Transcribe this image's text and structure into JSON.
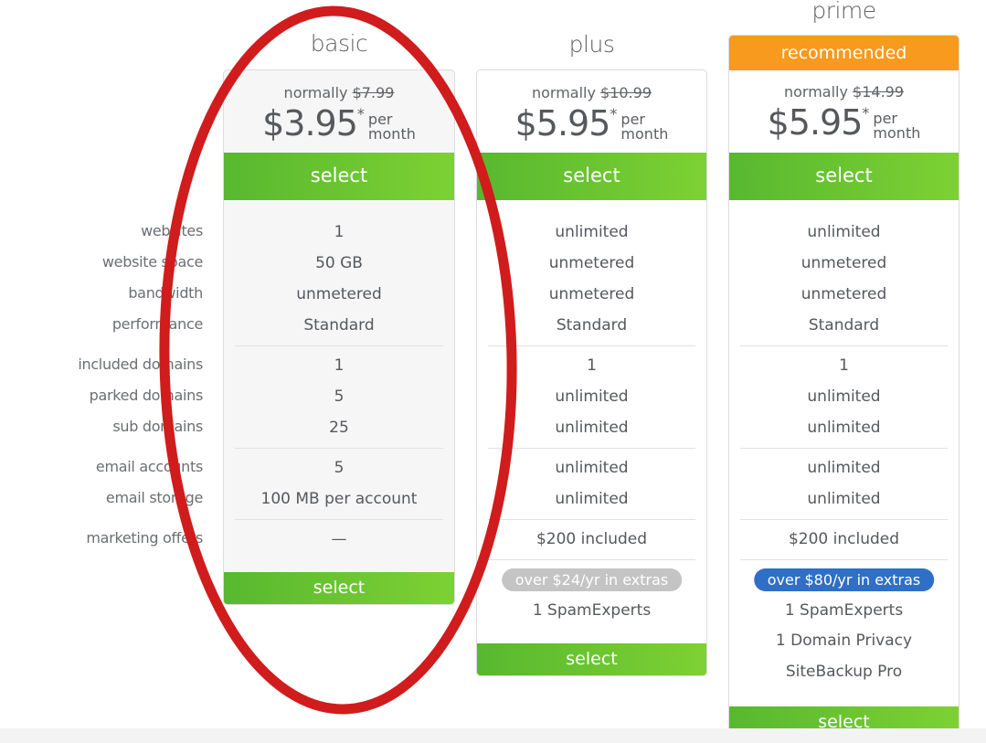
{
  "feature_labels": [
    "websites",
    "website space",
    "bandwidth",
    "performance",
    "included domains",
    "parked domains",
    "sub domains",
    "email accounts",
    "email storage",
    "marketing offers"
  ],
  "plans": [
    {
      "name": "basic",
      "ribbon": null,
      "normally_label": "normally",
      "old_price": "$7.99",
      "price": "$3.95",
      "asterisk": "*",
      "per": "per",
      "month": "month",
      "select_label": "select",
      "values": [
        "1",
        "50 GB",
        "unmetered",
        "Standard",
        "1",
        "5",
        "25",
        "5",
        "100 MB per account",
        "—"
      ],
      "extras_badge": null,
      "extras": []
    },
    {
      "name": "plus",
      "ribbon": null,
      "normally_label": "normally",
      "old_price": "$10.99",
      "price": "$5.95",
      "asterisk": "*",
      "per": "per",
      "month": "month",
      "select_label": "select",
      "values": [
        "unlimited",
        "unmetered",
        "unmetered",
        "Standard",
        "1",
        "unlimited",
        "unlimited",
        "unlimited",
        "unlimited",
        "$200 included"
      ],
      "extras_badge": "over $24/yr in extras",
      "extras": [
        "1 SpamExperts"
      ]
    },
    {
      "name": "prime",
      "ribbon": "recommended",
      "normally_label": "normally",
      "old_price": "$14.99",
      "price": "$5.95",
      "asterisk": "*",
      "per": "per",
      "month": "month",
      "select_label": "select",
      "values": [
        "unlimited",
        "unmetered",
        "unmetered",
        "Standard",
        "1",
        "unlimited",
        "unlimited",
        "unlimited",
        "unlimited",
        "$200 included"
      ],
      "extras_badge": "over $80/yr in extras",
      "extras": [
        "1 SpamExperts",
        "1 Domain Privacy",
        "SiteBackup Pro"
      ]
    }
  ],
  "colors": {
    "select_green": "#6cc431",
    "recommended_orange": "#f79a1e",
    "badge_gray": "#c4c4c4",
    "badge_blue": "#2f6fc6",
    "annotation_red": "#d01c1c"
  },
  "annotation": "red-oval-around-basic-plan"
}
